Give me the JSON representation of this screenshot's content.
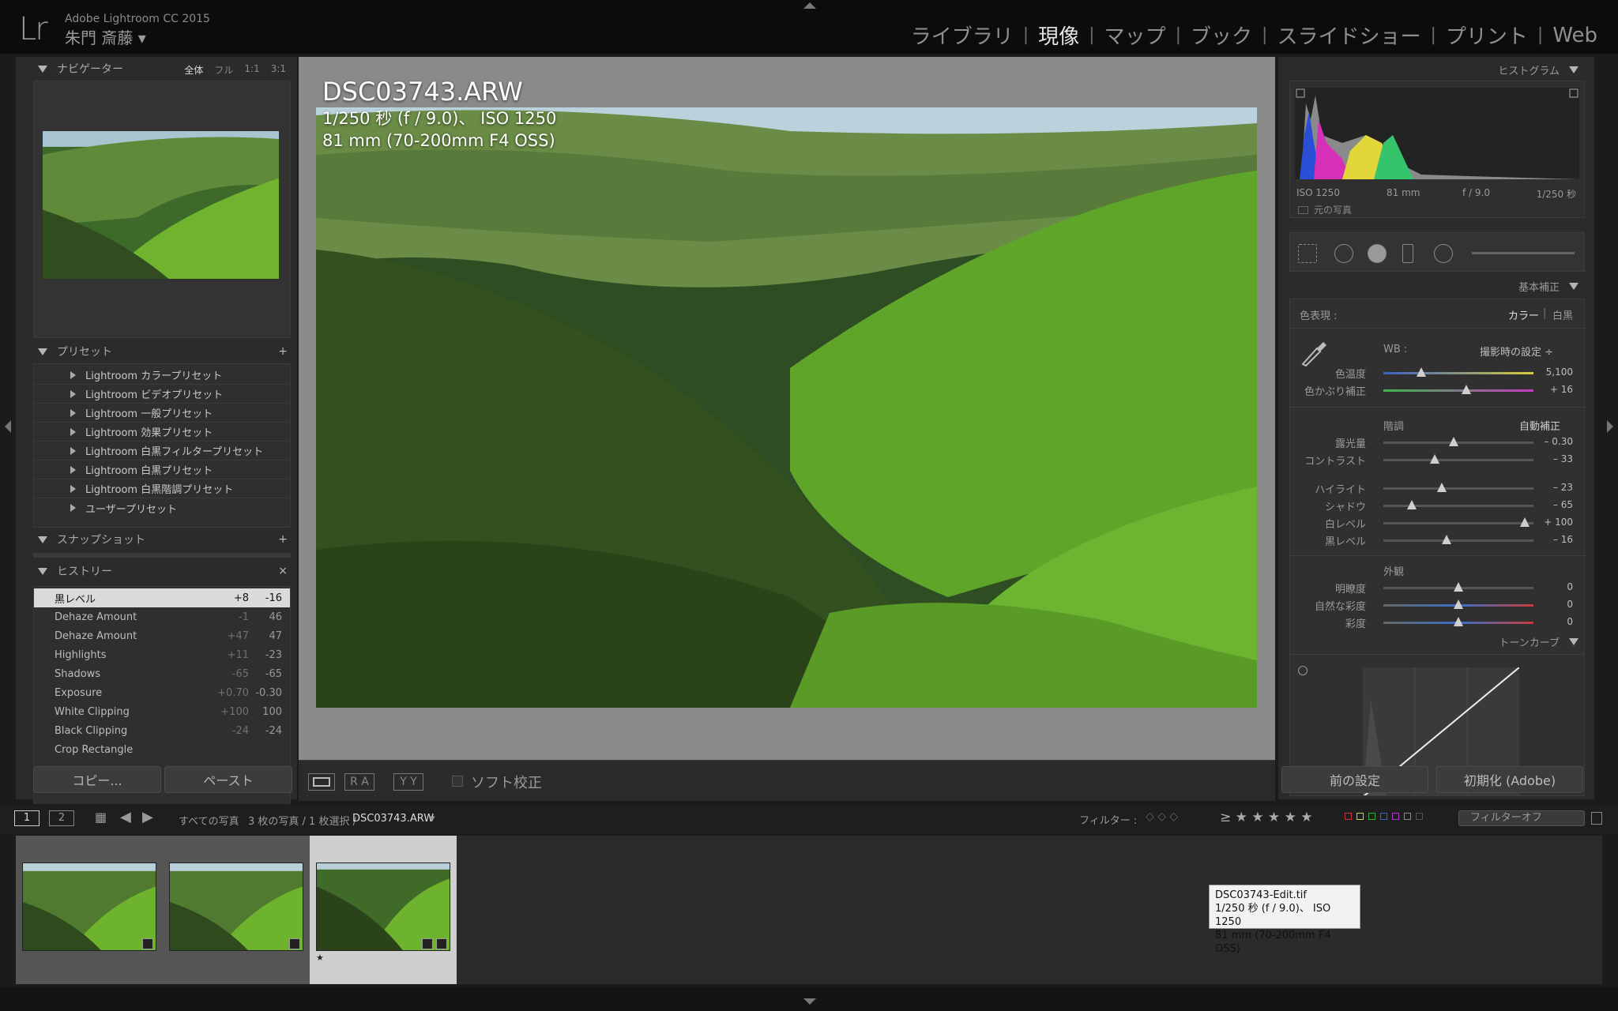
{
  "app": {
    "logo": "Lr",
    "title": "Adobe Lightroom CC 2015",
    "user": "朱門 斎藤 ▾"
  },
  "modules": [
    "ライブラリ",
    "現像",
    "マップ",
    "ブック",
    "スライドショー",
    "プリント",
    "Web"
  ],
  "active_module": "現像",
  "left_panel": {
    "navigator": {
      "title": "ナビゲーター",
      "options": [
        "全体",
        "フル",
        "1:1",
        "3:1"
      ]
    },
    "presets": {
      "title": "プリセット",
      "add": "+",
      "items": [
        "Lightroom カラープリセット",
        "Lightroom ビデオプリセット",
        "Lightroom 一般プリセット",
        "Lightroom 効果プリセット",
        "Lightroom 白黒フィルタープリセット",
        "Lightroom 白黒プリセット",
        "Lightroom 白黒階調プリセット",
        "ユーザープリセット"
      ]
    },
    "snapshots": {
      "title": "スナップショット",
      "add": "+"
    },
    "history": {
      "title": "ヒストリー",
      "close": "×",
      "rows": [
        {
          "name": "黒レベル",
          "delta": "+8",
          "value": "-16"
        },
        {
          "name": "Dehaze Amount",
          "delta": "-1",
          "value": "46"
        },
        {
          "name": "Dehaze Amount",
          "delta": "+47",
          "value": "47"
        },
        {
          "name": "Highlights",
          "delta": "+11",
          "value": "-23"
        },
        {
          "name": "Shadows",
          "delta": "-65",
          "value": "-65"
        },
        {
          "name": "Exposure",
          "delta": "+0.70",
          "value": "-0.30"
        },
        {
          "name": "White Clipping",
          "delta": "+100",
          "value": "100"
        },
        {
          "name": "Black Clipping",
          "delta": "-24",
          "value": "-24"
        },
        {
          "name": "Crop Rectangle",
          "delta": "",
          "value": ""
        }
      ]
    },
    "copy_label": "コピー...",
    "paste_label": "ペースト"
  },
  "photo": {
    "filename": "DSC03743.ARW",
    "exposure": "1/250 秒 (f / 9.0)、 ISO 1250",
    "lens": "81 mm (70-200mm F4 OSS)"
  },
  "center_toolbar": {
    "soft_proof": "ソフト校正",
    "ra": "R A",
    "yy": "Y Y"
  },
  "right_panel": {
    "histogram": {
      "title": "ヒストグラム",
      "iso": "ISO 1250",
      "focal": "81 mm",
      "aperture": "f / 9.0",
      "shutter": "1/250 秒",
      "original": "元の写真"
    },
    "basic": {
      "title": "基本補正",
      "treatment_label": "色表現 :",
      "color": "カラー",
      "bw": "白黒",
      "wb_label": "WB :",
      "wb_value": "撮影時の設定 ÷",
      "tone_label": "階調",
      "auto": "自動補正",
      "presence_label": "外観",
      "sliders": [
        {
          "label": "色温度",
          "value": "5,100",
          "pos": 0.25
        },
        {
          "label": "色かぶり補正",
          "value": "+ 16",
          "pos": 0.55
        },
        {
          "label": "露光量",
          "value": "– 0.30",
          "pos": 0.47
        },
        {
          "label": "コントラスト",
          "value": "– 33",
          "pos": 0.34
        },
        {
          "label": "ハイライト",
          "value": "– 23",
          "pos": 0.39
        },
        {
          "label": "シャドウ",
          "value": "– 65",
          "pos": 0.19
        },
        {
          "label": "白レベル",
          "value": "+ 100",
          "pos": 0.94
        },
        {
          "label": "黒レベル",
          "value": "– 16",
          "pos": 0.42
        },
        {
          "label": "明瞭度",
          "value": "0",
          "pos": 0.5
        },
        {
          "label": "自然な彩度",
          "value": "0",
          "pos": 0.5
        },
        {
          "label": "彩度",
          "value": "0",
          "pos": 0.5
        }
      ]
    },
    "tone_curve": {
      "title": "トーンカーブ"
    },
    "prev_label": "前の設定",
    "reset_label": "初期化 (Adobe)"
  },
  "filmstrip": {
    "page1": "1",
    "page2": "2",
    "source": "すべての写真",
    "count": "3 枚の写真 / 1 枚選択 /",
    "current": "DSC03743.ARW",
    "filter_label": "フィルター :",
    "rating_sym": "≥ ★ ★ ★ ★ ★",
    "filter_value": "フィルターオフ",
    "tooltip": [
      "DSC03743-Edit.tif",
      "1/250 秒 (f / 9.0)、 ISO 1250",
      "81 mm (70-200mm F4 OSS)"
    ],
    "star": "★"
  },
  "colors": {
    "accent": "#e6e6e6",
    "panel": "#2b2b2b",
    "background": "#8a8a8a"
  }
}
